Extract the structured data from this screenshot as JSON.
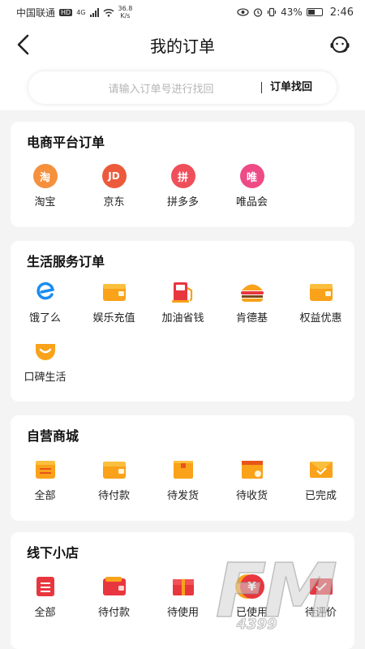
{
  "status_bar": {
    "carrier": "中国联通",
    "hd": "HD",
    "net": "4G",
    "speed_value": "36.8",
    "speed_unit": "K/s",
    "battery": "43%",
    "time": "2:46"
  },
  "header": {
    "title": "我的订单"
  },
  "search": {
    "placeholder": "请输入订单号进行找回",
    "button": "订单找回"
  },
  "sections": [
    {
      "title": "电商平台订单",
      "items": [
        {
          "label": "淘宝",
          "icon": "taobao-icon",
          "glyph": "淘",
          "color": "#f5903d"
        },
        {
          "label": "京东",
          "icon": "jd-icon",
          "glyph": "JD",
          "color": "#ec5a3c"
        },
        {
          "label": "拼多多",
          "icon": "pinduoduo-icon",
          "glyph": "拼",
          "color": "#ef4f5b"
        },
        {
          "label": "唯品会",
          "icon": "vipshop-icon",
          "glyph": "唯",
          "color": "#ee4b86"
        }
      ]
    },
    {
      "title": "生活服务订单",
      "items": [
        {
          "label": "饿了么",
          "icon": "eleme-icon"
        },
        {
          "label": "娱乐充值",
          "icon": "wallet-icon"
        },
        {
          "label": "加油省钱",
          "icon": "fuel-pump-icon"
        },
        {
          "label": "肯德基",
          "icon": "burger-icon"
        },
        {
          "label": "权益优惠",
          "icon": "card-icon"
        },
        {
          "label": "口碑生活",
          "icon": "koubei-icon"
        }
      ]
    },
    {
      "title": "自营商城",
      "items": [
        {
          "label": "全部",
          "icon": "list-icon"
        },
        {
          "label": "待付款",
          "icon": "wallet-icon"
        },
        {
          "label": "待发货",
          "icon": "box-icon"
        },
        {
          "label": "待收货",
          "icon": "receive-icon"
        },
        {
          "label": "已完成",
          "icon": "complete-icon"
        }
      ]
    },
    {
      "title": "线下小店",
      "items": [
        {
          "label": "全部",
          "icon": "list-icon"
        },
        {
          "label": "待付款",
          "icon": "wallet-icon"
        },
        {
          "label": "待使用",
          "icon": "gift-icon"
        },
        {
          "label": "已使用",
          "icon": "yen-coin-icon",
          "glyph": "¥"
        },
        {
          "label": "待评价",
          "icon": "review-icon"
        }
      ]
    }
  ],
  "colors": {
    "accent_orange": "#f9a21a",
    "accent_red": "#e8363f",
    "background": "#f4f4f4"
  },
  "watermark": {
    "text": "FM",
    "sub": "4399"
  }
}
